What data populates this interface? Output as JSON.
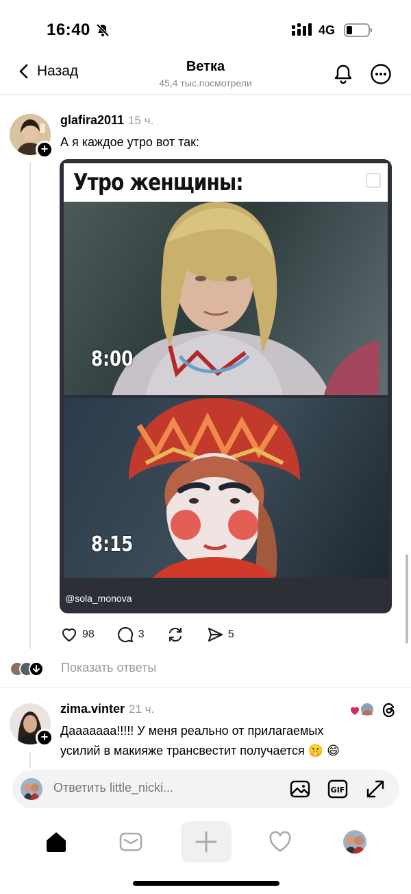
{
  "status_bar": {
    "time": "16:40",
    "network": "4G"
  },
  "header": {
    "back_label": "Назад",
    "title": "Ветка",
    "views": "45,4 тыс.посмотрели"
  },
  "post": {
    "username": "glafira2011",
    "time": "15 ч.",
    "text": "А я каждое утро вот так:",
    "meme": {
      "title": "Утро женщины:",
      "time1": "8:00",
      "time2": "8:15",
      "watermark": "@sola_monova"
    },
    "likes": "98",
    "comments": "3",
    "shares": "5",
    "show_replies": "Показать ответы"
  },
  "reply": {
    "username": "zima.vinter",
    "time": "21 ч.",
    "text_line1": "Дааааааа!!!!! У меня реально от прилагаемых",
    "text_line2": "усилий в макияже трансвестит получается 🤫 😄"
  },
  "reply_bar": {
    "placeholder": "Ответить little_nicki..."
  },
  "colors": {
    "accent": "#000000",
    "muted": "#9a9a9a",
    "like_red": "#e0245e"
  }
}
